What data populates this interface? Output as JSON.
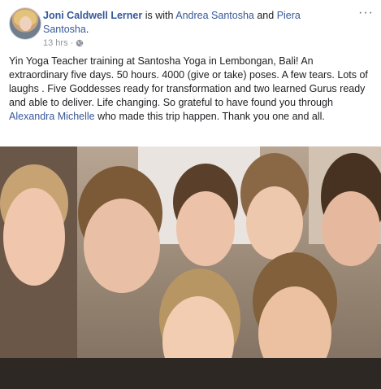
{
  "post": {
    "author": "Joni Caldwell Lerner",
    "is_with_text": " is with ",
    "tagged_1": "Andrea Santosha",
    "and_text": " and ",
    "tagged_2": "Piera Santosha",
    "period": ".",
    "time": "13 hrs",
    "dot": " · ",
    "more_label": "···",
    "text_part1": "Yin Yoga Teacher training at Santosha Yoga in Lembongan, Bali! An extraordinary five days. 50 hours. 4000 (give or take) poses. A few tears. Lots of laughs . Five Goddesses ready for transformation and two learned Gurus ready and able to deliver. Life changing. So grateful to have found you through ",
    "mention": "Alexandra Michelle",
    "text_part2": " who made this trip happen. Thank you one and all."
  },
  "icons": {
    "globe": "globe-icon",
    "more": "more-options-icon",
    "avatar": "profile-avatar"
  }
}
